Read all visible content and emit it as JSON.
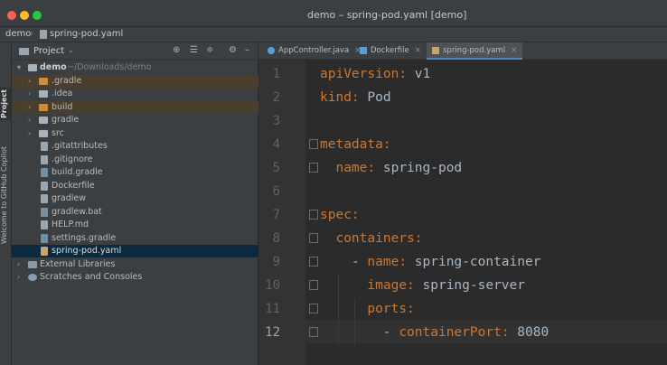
{
  "window": {
    "title": "demo – spring-pod.yaml [demo]",
    "traffic_colors": {
      "close": "#fe5f57",
      "minimize": "#febc2e",
      "zoom": "#28c840"
    }
  },
  "navbar": {
    "crumbs": [
      "demo",
      "spring-pod.yaml"
    ]
  },
  "left_strip": {
    "project_tab": "Project",
    "copilot_tab": "Welcome to GitHub Copilot"
  },
  "project_panel": {
    "title": "Project",
    "toolbar_icons": [
      "target-icon",
      "expand-all-icon",
      "collapse-all-icon",
      "gear-icon",
      "minimize-icon"
    ],
    "tree": [
      {
        "label": "demo",
        "hint": "~/Downloads/demo",
        "kind": "root-folder"
      },
      {
        "label": ".gradle",
        "kind": "folder-orange"
      },
      {
        "label": ".idea",
        "kind": "folder"
      },
      {
        "label": "build",
        "kind": "folder-orange"
      },
      {
        "label": "gradle",
        "kind": "folder"
      },
      {
        "label": "src",
        "kind": "folder"
      },
      {
        "label": ".gitattributes",
        "kind": "file"
      },
      {
        "label": ".gitignore",
        "kind": "file"
      },
      {
        "label": "build.gradle",
        "kind": "gradle-file"
      },
      {
        "label": "Dockerfile",
        "kind": "file"
      },
      {
        "label": "gradlew",
        "kind": "file"
      },
      {
        "label": "gradlew.bat",
        "kind": "bat-file"
      },
      {
        "label": "HELP.md",
        "kind": "file"
      },
      {
        "label": "settings.gradle",
        "kind": "gradle-file"
      },
      {
        "label": "spring-pod.yaml",
        "kind": "yaml-file",
        "selected": true
      },
      {
        "label": "External Libraries",
        "kind": "library"
      },
      {
        "label": "Scratches and Consoles",
        "kind": "scratches"
      }
    ]
  },
  "editor": {
    "tabs": [
      {
        "label": "AppController.java",
        "color": "#5c9fd6",
        "active": false
      },
      {
        "label": "Dockerfile",
        "color": "#5c9fd6",
        "active": false
      },
      {
        "label": "spring-pod.yaml",
        "color": "#c7a66b",
        "active": true
      }
    ],
    "current_line": 12,
    "lines": [
      {
        "n": "1",
        "key": "apiVersion",
        "sep": ": ",
        "val": "v1"
      },
      {
        "n": "2",
        "key": "kind",
        "sep": ": ",
        "val": "Pod"
      },
      {
        "n": "3",
        "key": "",
        "sep": "",
        "val": ""
      },
      {
        "n": "4",
        "key": "metadata",
        "sep": ":",
        "val": ""
      },
      {
        "n": "5",
        "key": "  name",
        "sep": ": ",
        "val": "spring-pod"
      },
      {
        "n": "6",
        "key": "",
        "sep": "",
        "val": ""
      },
      {
        "n": "7",
        "key": "spec",
        "sep": ":",
        "val": ""
      },
      {
        "n": "8",
        "key": "  containers",
        "sep": ":",
        "val": ""
      },
      {
        "n": "9",
        "dash": "    - ",
        "key": "name",
        "sep": ": ",
        "val": "spring-container"
      },
      {
        "n": "10",
        "key": "      image",
        "sep": ": ",
        "val": "spring-server"
      },
      {
        "n": "11",
        "key": "      ports",
        "sep": ":",
        "val": ""
      },
      {
        "n": "12",
        "dash": "        - ",
        "key": "containerPort",
        "sep": ": ",
        "val": "8080"
      }
    ]
  }
}
